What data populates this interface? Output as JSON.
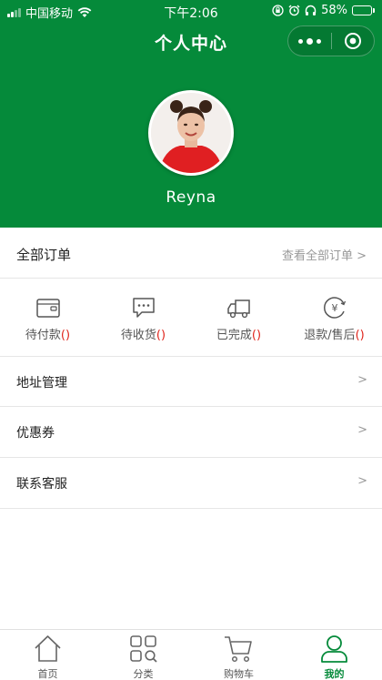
{
  "status_bar": {
    "carrier": "中国移动",
    "time": "下午2:06",
    "battery": "58%",
    "battery_level": 0.58
  },
  "nav": {
    "title": "个人中心"
  },
  "user": {
    "name": "Reyna"
  },
  "orders": {
    "title": "全部订单",
    "view_all": "查看全部订单 >"
  },
  "order_status": [
    {
      "label": "待付款",
      "count": "()",
      "icon": "wallet-icon"
    },
    {
      "label": "待收货",
      "count": "()",
      "icon": "chat-dots-icon"
    },
    {
      "label": "已完成",
      "count": "()",
      "icon": "truck-icon"
    },
    {
      "label": "退款/售后",
      "count": "()",
      "icon": "yen-refund-icon"
    }
  ],
  "menu": [
    {
      "label": "地址管理",
      "arrow": ">"
    },
    {
      "label": "优惠券",
      "arrow": ">"
    },
    {
      "label": "联系客服",
      "arrow": ">"
    }
  ],
  "tabs": [
    {
      "label": "首页",
      "icon": "home-icon"
    },
    {
      "label": "分类",
      "icon": "category-icon"
    },
    {
      "label": "购物车",
      "icon": "cart-icon"
    },
    {
      "label": "我的",
      "icon": "user-icon",
      "active": true
    }
  ],
  "colors": {
    "brand": "#058a3a",
    "count": "#e0241b"
  }
}
